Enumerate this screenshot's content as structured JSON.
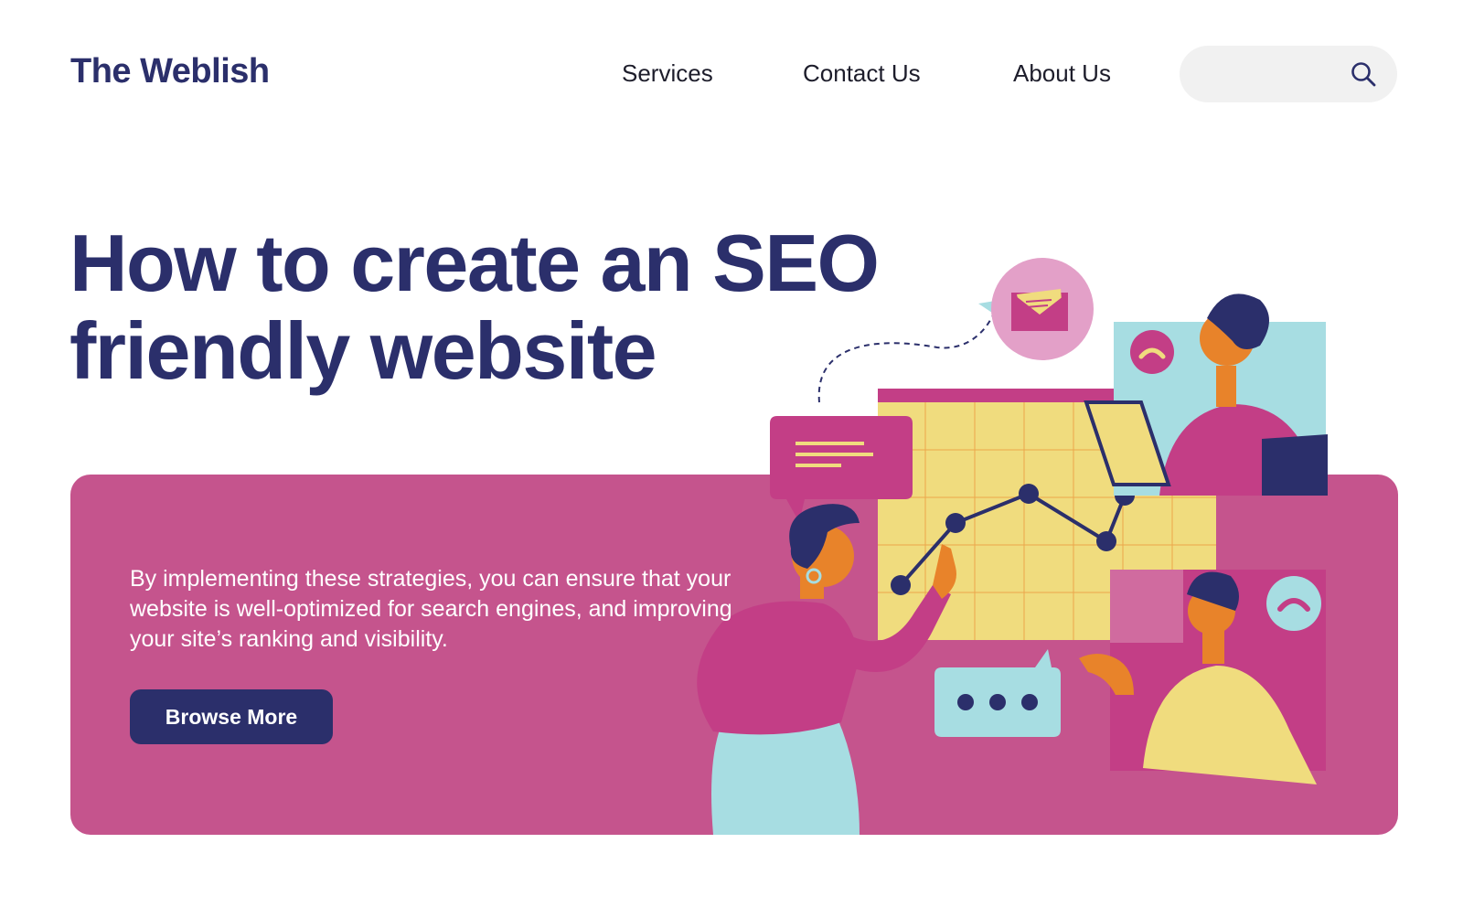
{
  "brand": {
    "logo_text": "The Weblish"
  },
  "nav": {
    "items": [
      {
        "label": "Services"
      },
      {
        "label": "Contact Us"
      },
      {
        "label": "About Us"
      }
    ]
  },
  "search": {
    "placeholder": "",
    "value": "",
    "icon": "search-icon"
  },
  "hero": {
    "title_line1": "How to create an SEO",
    "title_line2": "friendly website",
    "description": "By implementing these strategies, you can ensure that your website is well-optimized for search engines, and improving your site’s ranking and visibility.",
    "cta_label": "Browse More"
  },
  "colors": {
    "brand_navy": "#2b2f6b",
    "banner_pink": "#c5548d",
    "accent_yellow": "#f0dc7e",
    "accent_teal": "#a7dde2",
    "accent_orange": "#e8832a",
    "magenta": "#c33e86",
    "search_bg": "#f1f1f1"
  }
}
